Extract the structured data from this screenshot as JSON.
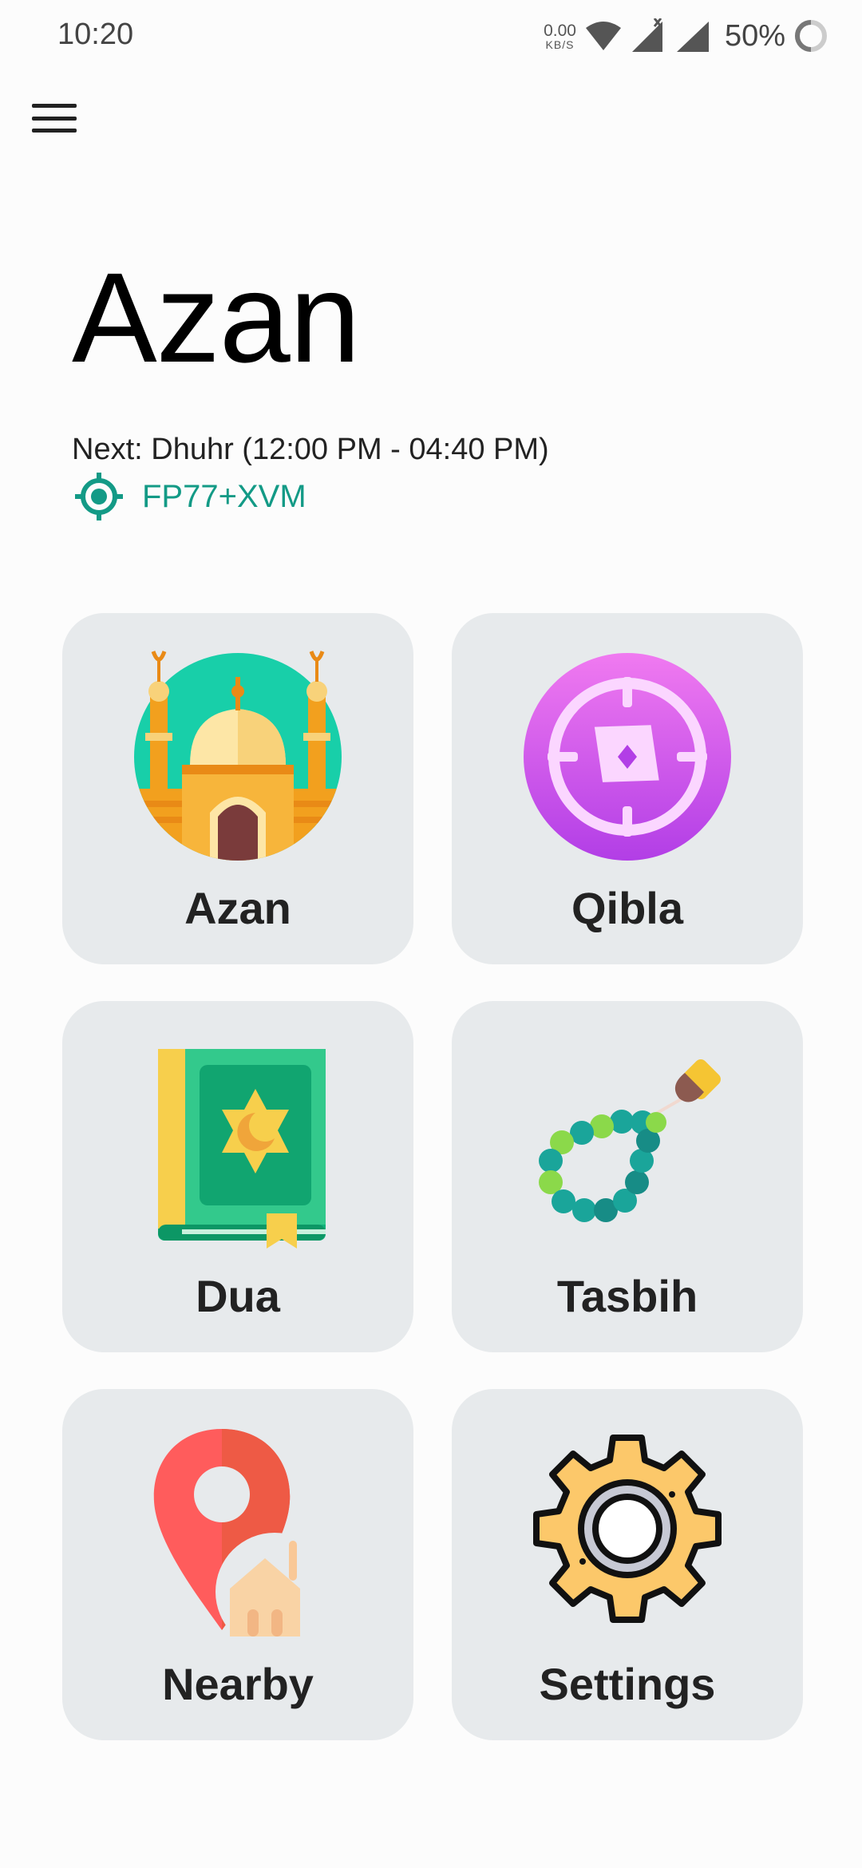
{
  "status_bar": {
    "time": "10:20",
    "net_speed_value": "0.00",
    "net_speed_unit": "KB/S",
    "battery": "50%",
    "icons": [
      "wifi-icon",
      "signal-icon",
      "signal-icon",
      "battery-icon"
    ]
  },
  "header": {
    "menu_icon": "hamburger-menu-icon",
    "title": "Azan",
    "next_prayer": "Next: Dhuhr (12:00 PM - 04:40 PM)",
    "location": "FP77+XVM",
    "location_icon": "location-target-icon"
  },
  "tiles": [
    {
      "label": "Azan",
      "icon": "mosque-icon"
    },
    {
      "label": "Qibla",
      "icon": "compass-icon"
    },
    {
      "label": "Dua",
      "icon": "quran-book-icon"
    },
    {
      "label": "Tasbih",
      "icon": "prayer-beads-icon"
    },
    {
      "label": "Nearby",
      "icon": "nearby-mosque-pin-icon"
    },
    {
      "label": "Settings",
      "icon": "gear-icon"
    }
  ],
  "colors": {
    "accent": "#139a86",
    "card_bg": "#e7eaec",
    "background": "#fcfcfc"
  }
}
